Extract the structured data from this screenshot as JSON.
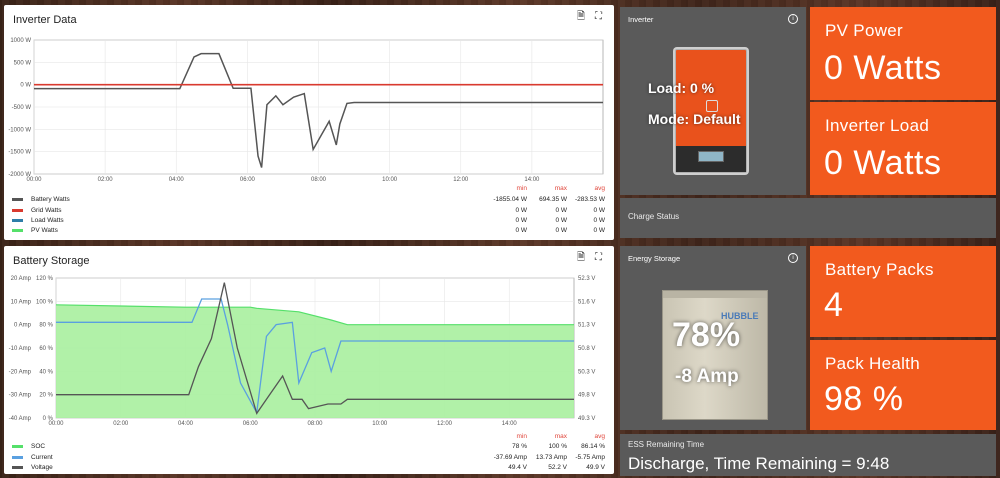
{
  "inverter_chart": {
    "title": "Inverter Data",
    "y_ticks": [
      "1000 W",
      "500 W",
      "0 W",
      "-500 W",
      "-1000 W",
      "-1500 W",
      "-2000 W"
    ],
    "x_ticks": [
      "00:00",
      "02:00",
      "04:00",
      "06:00",
      "08:00",
      "10:00",
      "12:00",
      "14:00"
    ],
    "legend_headers": {
      "min": "min",
      "max": "max",
      "avg": "avg"
    },
    "series": [
      {
        "name": "Battery Watts",
        "color": "#555555",
        "min": "-1855.04 W",
        "max": "694.35 W",
        "avg": "-283.53 W"
      },
      {
        "name": "Grid Watts",
        "color": "#d93a2f",
        "min": "0 W",
        "max": "0 W",
        "avg": "0 W"
      },
      {
        "name": "Load Watts",
        "color": "#2e7ea8",
        "min": "0 W",
        "max": "0 W",
        "avg": "0 W"
      },
      {
        "name": "PV Watts",
        "color": "#55e06a",
        "min": "0 W",
        "max": "0 W",
        "avg": "0 W"
      }
    ]
  },
  "battery_chart": {
    "title": "Battery Storage",
    "y_left_amp": [
      "20 Amp",
      "10 Amp",
      "0 Amp",
      "-10 Amp",
      "-20 Amp",
      "-30 Amp",
      "-40 Amp"
    ],
    "y_left_pct": [
      "120 %",
      "100 %",
      "80 %",
      "60 %",
      "40 %",
      "20 %",
      "0 %"
    ],
    "y_right": [
      "52.3 V",
      "51.6 V",
      "51.3 V",
      "50.8 V",
      "50.3 V",
      "49.8 V",
      "49.3 V"
    ],
    "x_ticks": [
      "00:00",
      "02:00",
      "04:00",
      "06:00",
      "08:00",
      "10:00",
      "12:00",
      "14:00"
    ],
    "legend_headers": {
      "min": "min",
      "max": "max",
      "avg": "avg"
    },
    "series": [
      {
        "name": "SOC",
        "color": "#55e06a",
        "min": "78 %",
        "max": "100 %",
        "avg": "86.14 %"
      },
      {
        "name": "Current",
        "color": "#5aa0e0",
        "min": "-37.69 Amp",
        "max": "13.73 Amp",
        "avg": "-5.75 Amp"
      },
      {
        "name": "Voltage",
        "color": "#555555",
        "min": "49.4 V",
        "max": "52.2 V",
        "avg": "49.9 V"
      }
    ]
  },
  "inverter_panel": {
    "title": "Inverter",
    "load": "Load: 0 %",
    "mode": "Mode: Default"
  },
  "pv_power": {
    "title": "PV Power",
    "value": "0 Watts"
  },
  "inverter_load": {
    "title": "Inverter Load",
    "value": "0 Watts"
  },
  "charge_status": {
    "title": "Charge Status"
  },
  "energy_storage": {
    "title": "Energy Storage",
    "soc": "78%",
    "current": "-8 Amp",
    "brand": "HUBBLE"
  },
  "battery_packs": {
    "title": "Battery Packs",
    "value": "4"
  },
  "pack_health": {
    "title": "Pack Health",
    "value": "98 %"
  },
  "ess_remaining": {
    "title": "ESS Remaining Time",
    "value": "Discharge, Time Remaining = 9:48"
  },
  "icons": {
    "export": "file-export-icon",
    "fullscreen": "fullscreen-icon",
    "info": "info-icon"
  },
  "colors": {
    "accent": "#f25a1e",
    "panel_grey": "#5a5a5a"
  }
}
